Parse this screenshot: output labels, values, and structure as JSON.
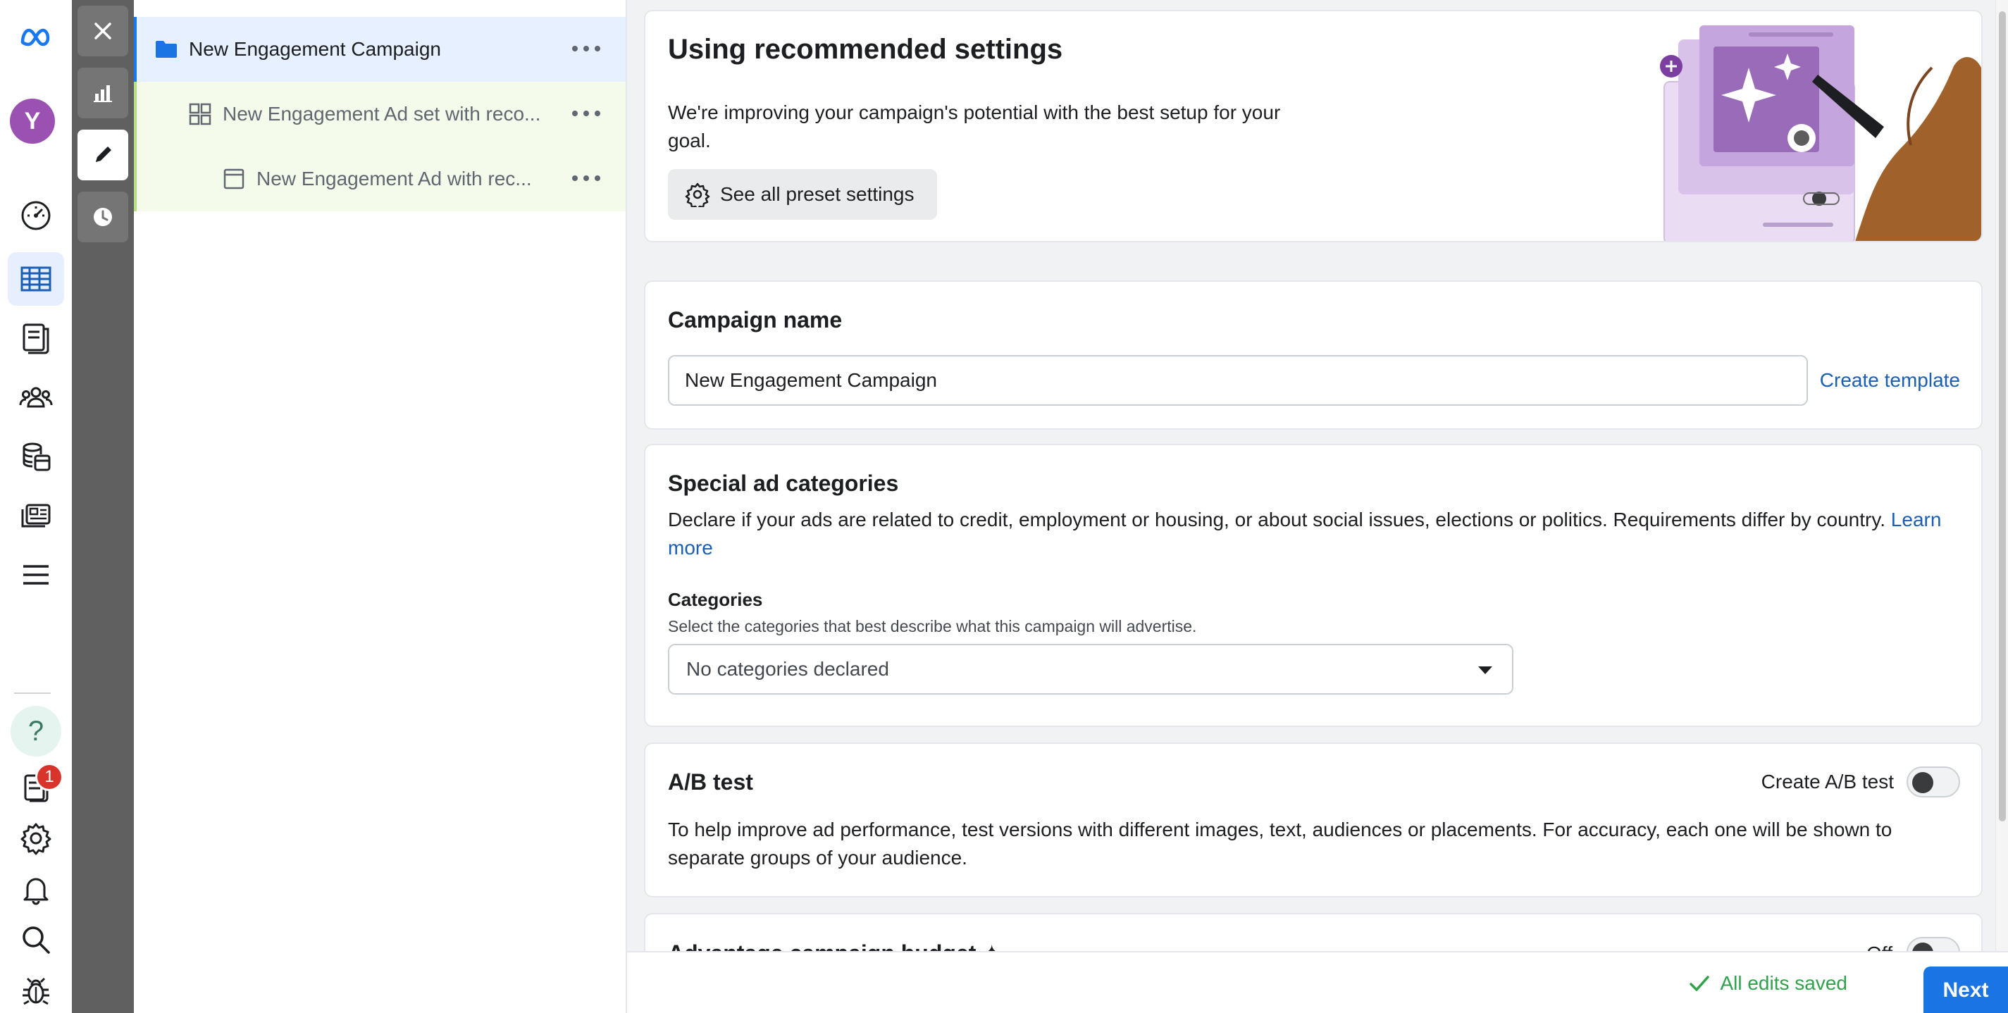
{
  "rail": {
    "avatar_initial": "Y",
    "notification_count": "1",
    "help_glyph": "?",
    "icons": [
      "meta-logo-icon",
      "account-overview-icon",
      "campaigns-table-icon",
      "ad-library-icon",
      "audiences-icon",
      "billing-icon",
      "ads-reporting-icon",
      "all-tools-menu-icon",
      "help-icon",
      "notifications-icon",
      "settings-icon",
      "alerts-bell-icon",
      "search-icon",
      "bug-report-icon"
    ]
  },
  "tool_strip": {
    "icons": [
      "close-icon",
      "bar-chart-icon",
      "pencil-icon",
      "clock-icon"
    ]
  },
  "tree": {
    "campaign": "New Engagement Campaign",
    "adset": "New Engagement Ad set with reco...",
    "ad": "New Engagement Ad with rec..."
  },
  "recommended": {
    "title": "Using recommended settings",
    "description": "We're improving your campaign's potential with the best setup for your goal.",
    "preset_button": "See all preset settings"
  },
  "campaign_name": {
    "title": "Campaign name",
    "value": "New Engagement Campaign",
    "create_template": "Create template"
  },
  "special": {
    "title": "Special ad categories",
    "description": "Declare if your ads are related to credit, employment or housing, or about social issues, elections or politics. Requirements differ by country.",
    "learn_more": "Learn more",
    "categories_label": "Categories",
    "categories_help": "Select the categories that best describe what this campaign will advertise.",
    "categories_value": "No categories declared"
  },
  "ab_test": {
    "title": "A/B test",
    "toggle_label": "Create A/B test",
    "description": "To help improve ad performance, test versions with different images, text, audiences or placements. For accuracy, each one will be shown to separate groups of your audience."
  },
  "budget": {
    "title": "Advantage campaign budget ✦",
    "state": "Off"
  },
  "footer": {
    "saved": "All edits saved",
    "next": "Next"
  },
  "colors": {
    "accent": "#1b74e4",
    "link": "#1a5fb4",
    "saved": "#31a24c",
    "avatar": "#9b51b1",
    "badge": "#d8342b"
  }
}
